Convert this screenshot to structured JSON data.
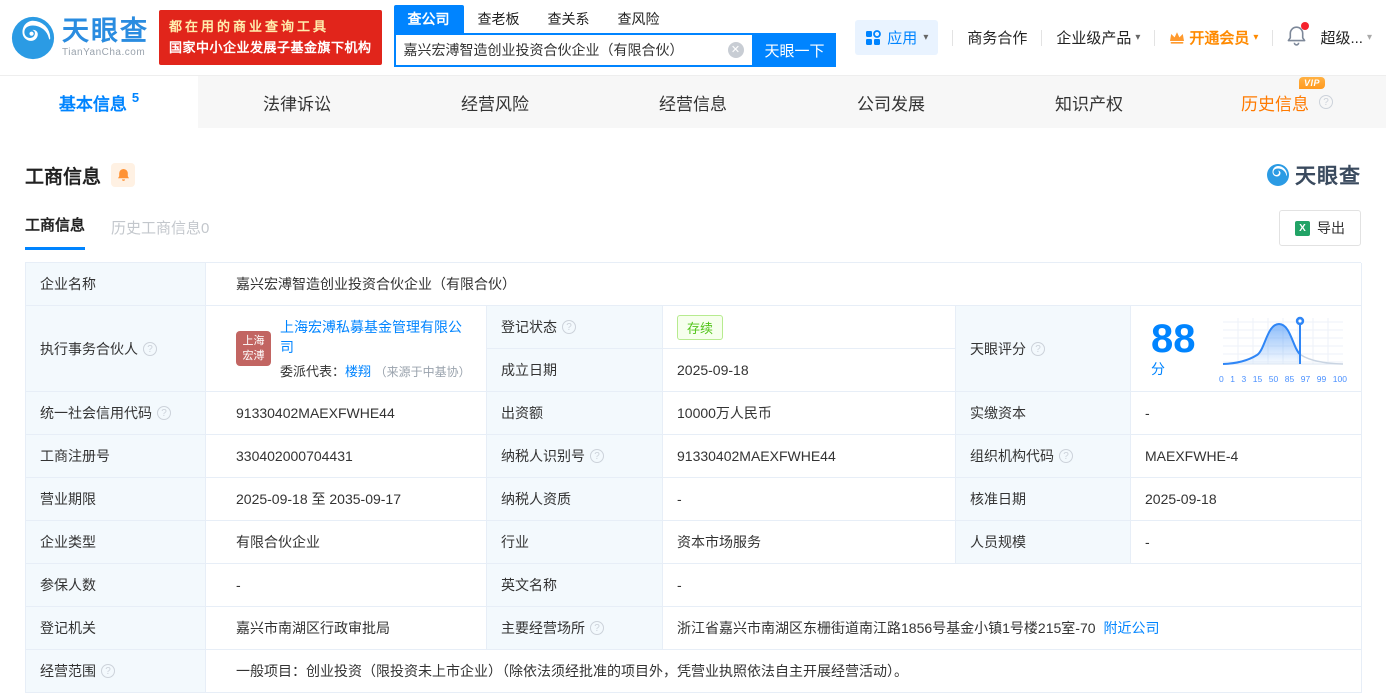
{
  "brand": {
    "name": "天眼查",
    "domain": "TianYanCha.com"
  },
  "promo": {
    "line1": "都在用的商业查询工具",
    "line2": "国家中小企业发展子基金旗下机构"
  },
  "search": {
    "tabs": [
      "查公司",
      "查老板",
      "查关系",
      "查风险"
    ],
    "value": "嘉兴宏溥智造创业投资合伙企业（有限合伙）",
    "submit": "天眼一下"
  },
  "topnav": {
    "apps": "应用",
    "cooperation": "商务合作",
    "enterprise": "企业级产品",
    "membership": "开通会员",
    "more": "超级..."
  },
  "tabs": {
    "basic": "基本信息",
    "basic_count": "5",
    "legal": "法律诉讼",
    "risk": "经营风险",
    "operating": "经营信息",
    "development": "公司发展",
    "ip": "知识产权",
    "history": "历史信息",
    "history_badge": "VIP"
  },
  "section": {
    "title": "工商信息",
    "subtab_active": "工商信息",
    "subtab_history": "历史工商信息0",
    "export": "导出",
    "watermark": "天眼查"
  },
  "fields": {
    "company_name_label": "企业名称",
    "company_name": "嘉兴宏溥智造创业投资合伙企业（有限合伙）",
    "partner_label": "执行事务合伙人",
    "partner_avatar_line1": "上海",
    "partner_avatar_line2": "宏溥",
    "partner_company": "上海宏溥私募基金管理有限公司",
    "rep_label": "委派代表：",
    "rep_name": "楼翔",
    "rep_source": "（来源于中基协）",
    "reg_status_label": "登记状态",
    "reg_status": "存续",
    "establish_label": "成立日期",
    "establish_date": "2025-09-18",
    "score_label": "天眼评分",
    "score": "88",
    "score_unit": "分",
    "uscc_label": "统一社会信用代码",
    "uscc": "91330402MAEXFWHE44",
    "capital_label": "出资额",
    "capital": "10000万人民币",
    "paid_label": "实缴资本",
    "paid": "-",
    "regno_label": "工商注册号",
    "regno": "330402000704431",
    "taxid_label": "纳税人识别号",
    "taxid": "91330402MAEXFWHE44",
    "orgcode_label": "组织机构代码",
    "orgcode": "MAEXFWHE-4",
    "term_label": "营业期限",
    "term": "2025-09-18 至 2035-09-17",
    "taxq_label": "纳税人资质",
    "taxq": "-",
    "approve_label": "核准日期",
    "approve_date": "2025-09-18",
    "type_label": "企业类型",
    "type": "有限合伙企业",
    "industry_label": "行业",
    "industry": "资本市场服务",
    "staff_label": "人员规模",
    "staff": "-",
    "insured_label": "参保人数",
    "insured": "-",
    "en_name_label": "英文名称",
    "en_name": "-",
    "authority_label": "登记机关",
    "authority": "嘉兴市南湖区行政审批局",
    "address_label": "主要经营场所",
    "address": "浙江省嘉兴市南湖区东栅街道南江路1856号基金小镇1号楼215室-70",
    "nearby": "附近公司",
    "scope_label": "经营范围",
    "scope": "一般项目：创业投资（限投资未上市企业）（除依法须经批准的项目外，凭营业执照依法自主开展经营活动）。"
  },
  "chart_data": {
    "type": "area",
    "title": "天眼评分分布曲线",
    "score": 88,
    "ticks": [
      "0",
      "1",
      "3",
      "15",
      "50",
      "85",
      "97",
      "99",
      "100"
    ],
    "marker_value": 88,
    "accent_color": "#2f86f6"
  }
}
